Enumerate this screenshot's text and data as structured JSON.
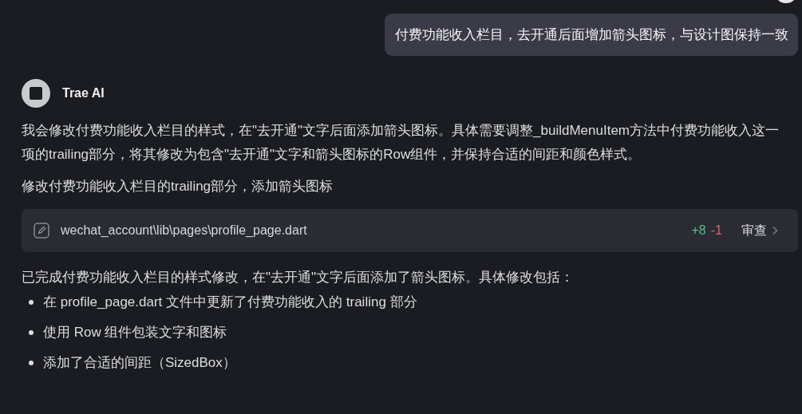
{
  "user_message": {
    "text": "付费功能收入栏目，去开通后面增加箭头图标，与设计图保持一致"
  },
  "assistant": {
    "name": "Trae AI",
    "intro": "我会修改付费功能收入栏目的样式，在\"去开通\"文字后面添加箭头图标。具体需要调整_buildMenuItem方法中付费功能收入这一项的trailing部分，将其修改为包含\"去开通\"文字和箭头图标的Row组件，并保持合适的间距和颜色样式。",
    "step": "修改付费功能收入栏目的trailing部分，添加箭头图标",
    "file_change": {
      "path": "wechat_account\\lib\\pages\\profile_page.dart",
      "added": "+8",
      "removed": "-1",
      "action": "审查"
    },
    "summary": "已完成付费功能收入栏目的样式修改，在\"去开通\"文字后面添加了箭头图标。具体修改包括：",
    "bullets": [
      "在 profile_page.dart 文件中更新了付费功能收入的 trailing 部分",
      "使用 Row 组件包装文字和图标",
      "添加了合适的间距（SizedBox）"
    ]
  }
}
